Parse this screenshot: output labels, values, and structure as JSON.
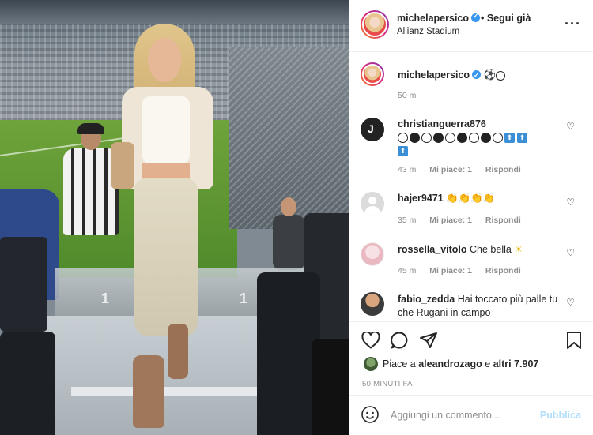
{
  "post": {
    "username": "michelapersico",
    "follow_label": "• Segui già",
    "location": "Allianz Stadium",
    "more_icon": "more-options-icon"
  },
  "caption": {
    "username": "michelapersico",
    "time": "50 m"
  },
  "comments": [
    {
      "username": "christianguerra876",
      "text": "",
      "time": "43 m",
      "likes": "Mi piace: 1",
      "reply": "Rispondi"
    },
    {
      "username": "hajer9471",
      "text": "",
      "time": "35 m",
      "likes": "Mi piace: 1",
      "reply": "Rispondi"
    },
    {
      "username": "rossella_vitolo",
      "text": "Che bella",
      "time": "45 m",
      "likes": "Mi piace: 1",
      "reply": "Rispondi"
    },
    {
      "username": "fabio_zedda",
      "text": "Hai toccato più palle tu che Rugani in campo",
      "time": "",
      "likes": "",
      "reply": ""
    }
  ],
  "actions": {
    "liked_by_prefix": "Piace a",
    "liked_by_user": "aleandrozago",
    "liked_by_suffix": "e",
    "others": "altri 7.907",
    "timestamp": "50 MINUTI FA"
  },
  "composer": {
    "placeholder": "Aggiungi un commento...",
    "post_label": "Pubblica"
  },
  "photo": {
    "seat_number_left": "1",
    "seat_number_right": "1"
  },
  "colors": {
    "verified": "#3897f0",
    "post_button_disabled": "#b2dffc",
    "meta_text": "#8e8e8e"
  }
}
